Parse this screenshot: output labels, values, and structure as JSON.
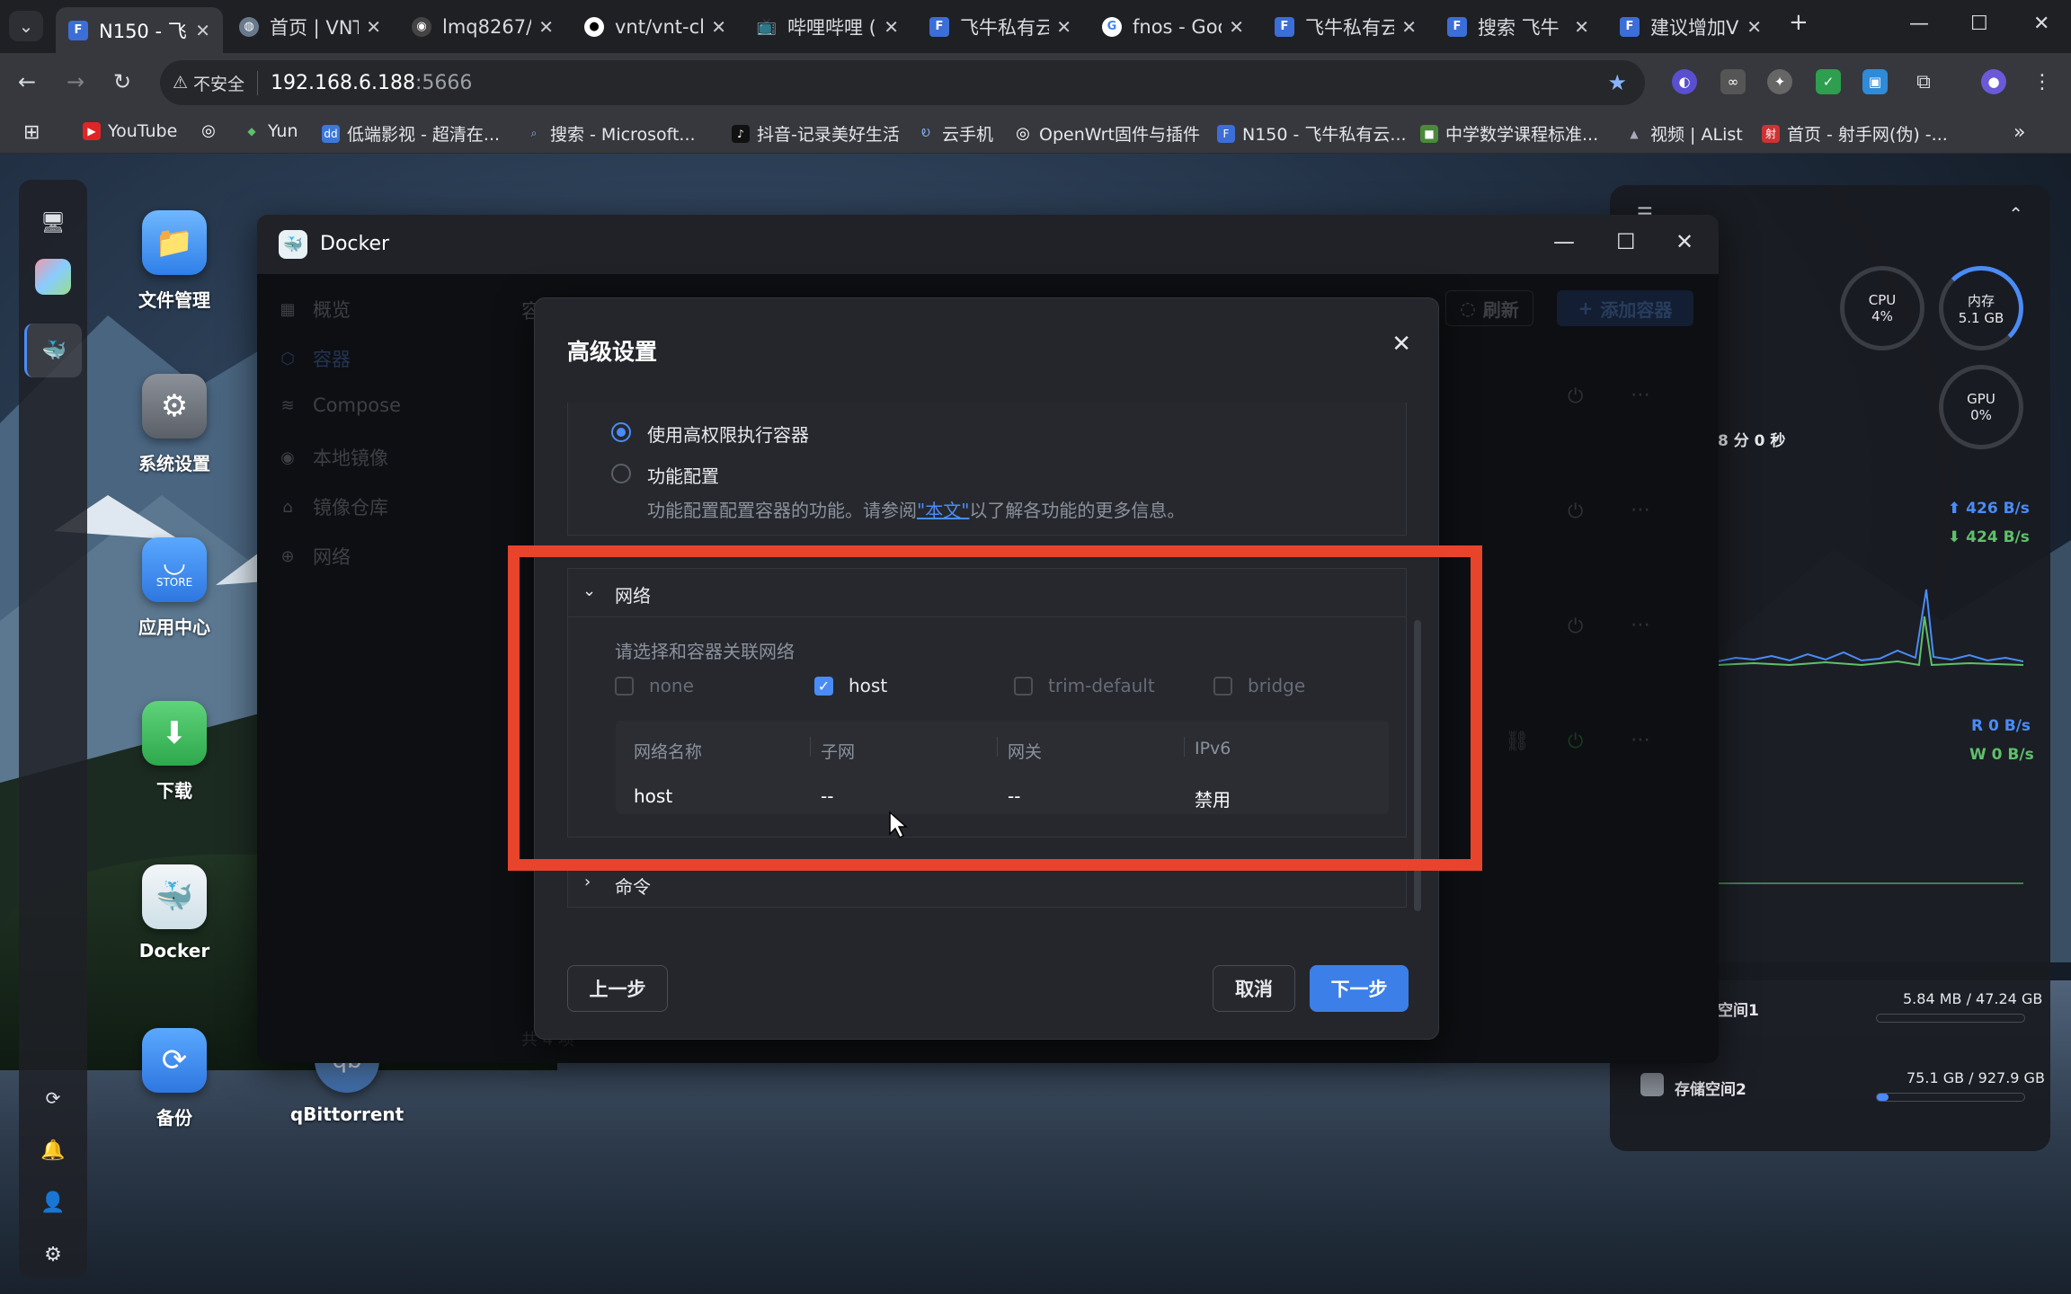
{
  "browser": {
    "tabs": [
      {
        "title": "N150 - 飞",
        "active": true
      },
      {
        "title": "首页 | VNT"
      },
      {
        "title": "lmq8267/"
      },
      {
        "title": "vnt/vnt-cl"
      },
      {
        "title": "哔哩哔哩 ("
      },
      {
        "title": "飞牛私有云"
      },
      {
        "title": "fnos - Goo"
      },
      {
        "title": "飞牛私有云"
      },
      {
        "title": "搜索 飞牛"
      },
      {
        "title": "建议增加V"
      }
    ],
    "address": {
      "insecure_label": "不安全",
      "host": "192.168.6.188",
      "port": ":5666"
    },
    "bookmarks": [
      "YouTube",
      "Yun",
      "低端影视 - 超清在...",
      "搜索 - Microsoft...",
      "抖音-记录美好生活",
      "云手机",
      "OpenWrt固件与插件",
      "N150 - 飞牛私有云...",
      "中学数学课程标准...",
      "视频 | AList",
      "首页 - 射手网(伪) -..."
    ]
  },
  "desktop": {
    "apps": [
      {
        "label": "文件管理"
      },
      {
        "label": "系统设置"
      },
      {
        "label": "应用中心",
        "badge": "STORE"
      },
      {
        "label": "下载"
      },
      {
        "label": "Docker"
      },
      {
        "label": "备份"
      },
      {
        "label": "qBittorrent"
      }
    ]
  },
  "widget": {
    "cpu_label": "CPU",
    "cpu_value": "4%",
    "mem_label": "内存",
    "mem_value": "5.1 GB",
    "gpu_label": "GPU",
    "gpu_value": "0%",
    "uptime": "8 分 0 秒",
    "net_up": "426 B/s",
    "net_down": "424 B/s",
    "disk_read": "R 0 B/s",
    "disk_write": "W 0 B/s",
    "storage1_label": "空间1",
    "storage1_value": "5.84 MB / 47.24 GB",
    "storage2_label": "存储空间2",
    "storage2_value": "75.1 GB / 927.9 GB"
  },
  "docker": {
    "title": "Docker",
    "sidebar": [
      "概览",
      "容器",
      "Compose",
      "本地镜像",
      "镜像仓库",
      "网络"
    ],
    "heading_partial": "容",
    "refresh_label": "刷新",
    "add_label": "添加容器",
    "footer_partial": "共 4 项"
  },
  "dialog": {
    "title": "高级设置",
    "privileged_label": "使用高权限执行容器",
    "capability_label": "功能配置",
    "capability_desc_pre": "功能配置配置容器的功能。请参阅",
    "capability_desc_link": "\"本文\"",
    "capability_desc_post": "以了解各功能的更多信息。",
    "network_section": "网络",
    "network_hint": "请选择和容器关联网络",
    "networks": [
      {
        "name": "none",
        "checked": false
      },
      {
        "name": "host",
        "checked": true
      },
      {
        "name": "trim-default",
        "checked": false
      },
      {
        "name": "bridge",
        "checked": false
      }
    ],
    "table": {
      "headers": [
        "网络名称",
        "子网",
        "网关",
        "IPv6"
      ],
      "row": [
        "host",
        "--",
        "--",
        "禁用"
      ]
    },
    "command_section": "命令",
    "prev_button": "上一步",
    "cancel_button": "取消",
    "next_button": "下一步"
  },
  "colors": {
    "accent": "#3c7fe8",
    "highlight": "#e8442b"
  }
}
